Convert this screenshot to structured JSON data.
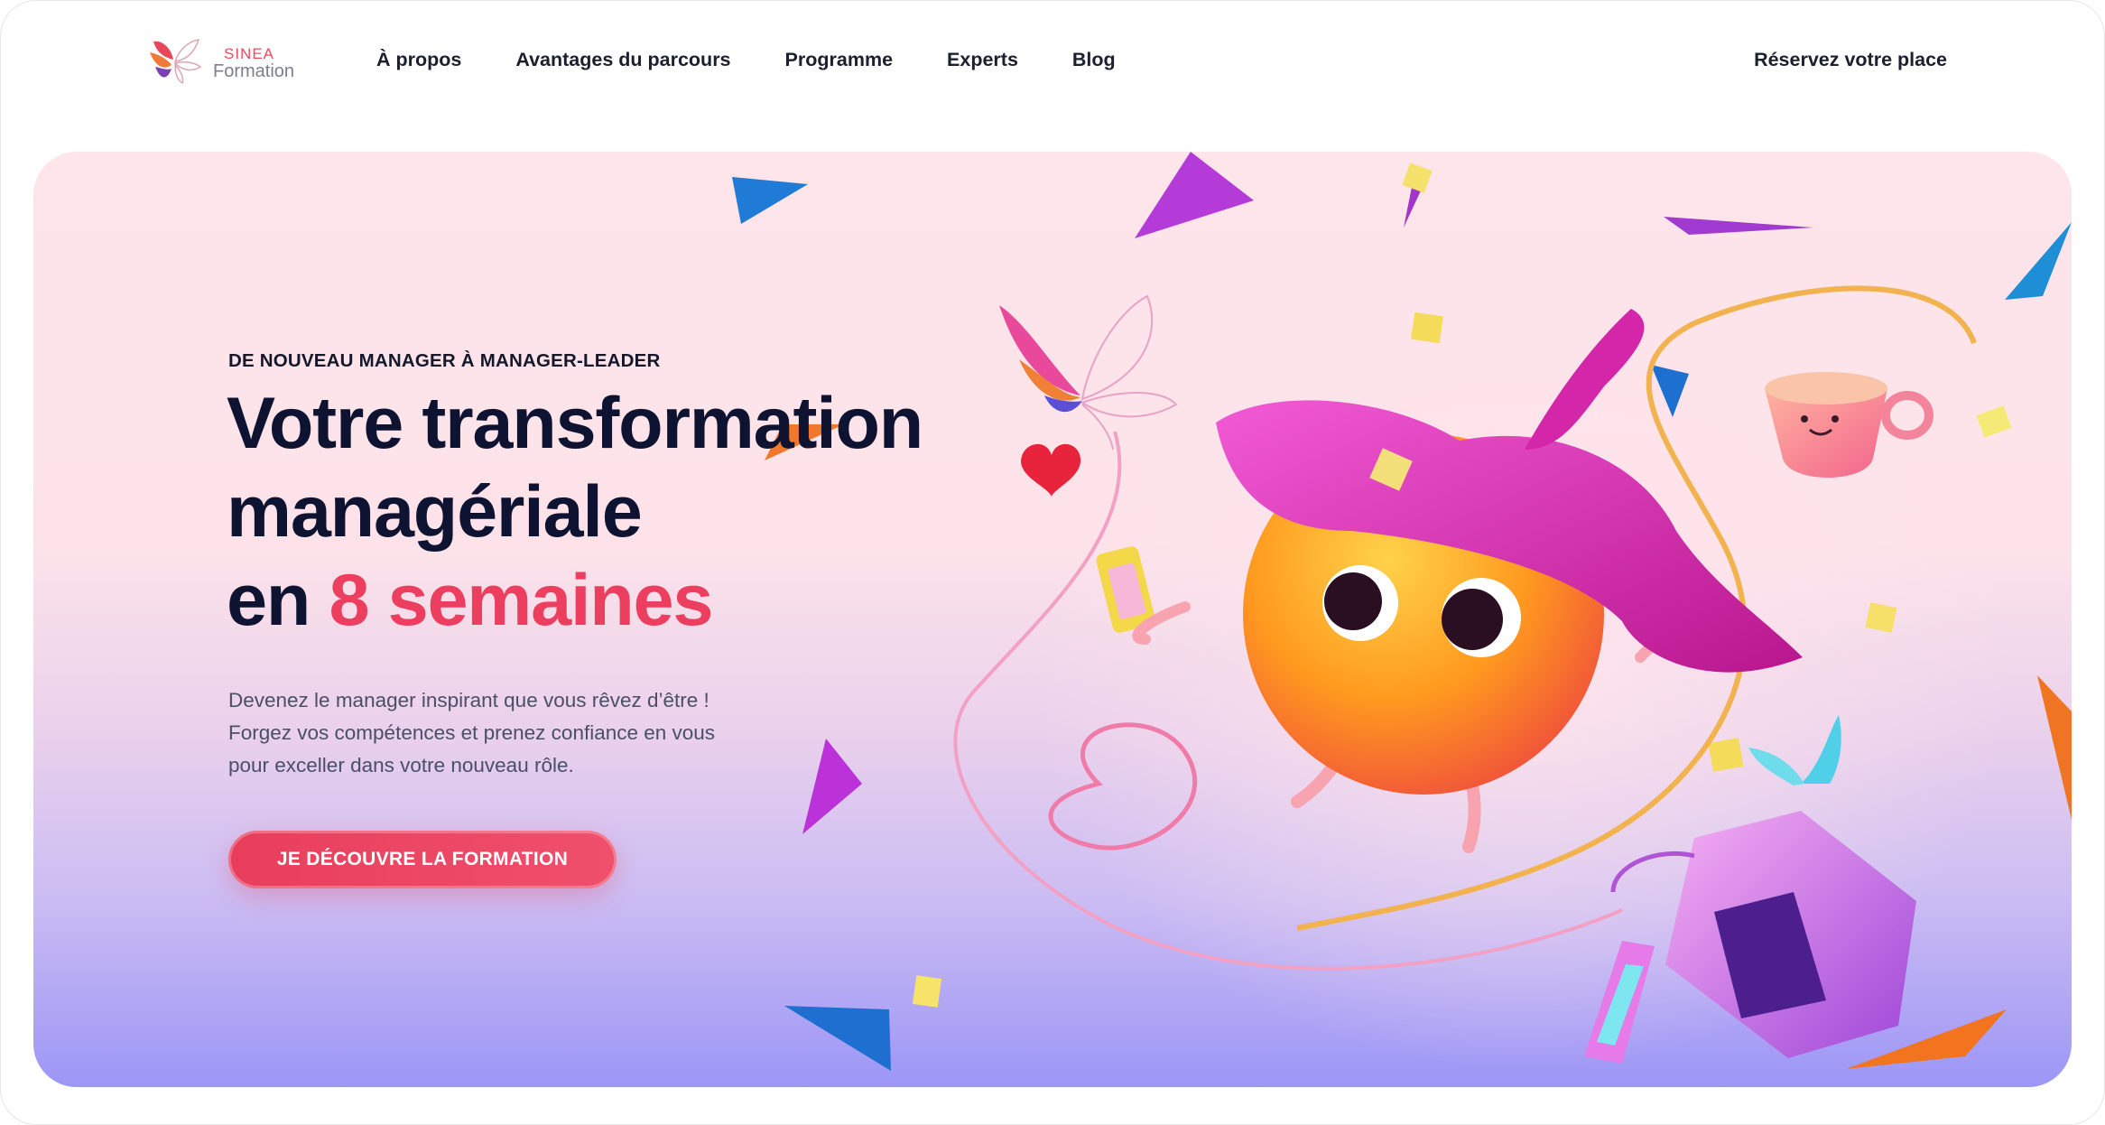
{
  "brand": {
    "name_line1": "SINEA",
    "name_line2": "Formation",
    "colors": {
      "red": "#ef4b5a",
      "navy": "#0d1330"
    }
  },
  "nav": {
    "items": [
      {
        "label": "À propos"
      },
      {
        "label": "Avantages du parcours"
      },
      {
        "label": "Programme"
      },
      {
        "label": "Experts"
      },
      {
        "label": "Blog"
      }
    ],
    "cta_label": "Réservez votre place"
  },
  "hero": {
    "eyebrow": "DE NOUVEAU MANAGER À MANAGER-LEADER",
    "headline": {
      "line1": "Votre transformation",
      "line2": "managériale",
      "line3_prefix": "en ",
      "line3_accent": "8 semaines"
    },
    "description": {
      "line1": "Devenez le manager inspirant que vous rêvez d’être !",
      "line2": "Forgez vos compétences et prenez confiance en vous",
      "line3": "pour exceller dans votre nouveau rôle."
    },
    "cta_label": "JE DÉCOUVRE LA FORMATION",
    "colors": {
      "accent": "#ec3e5f",
      "button": "#e83e5c"
    }
  }
}
